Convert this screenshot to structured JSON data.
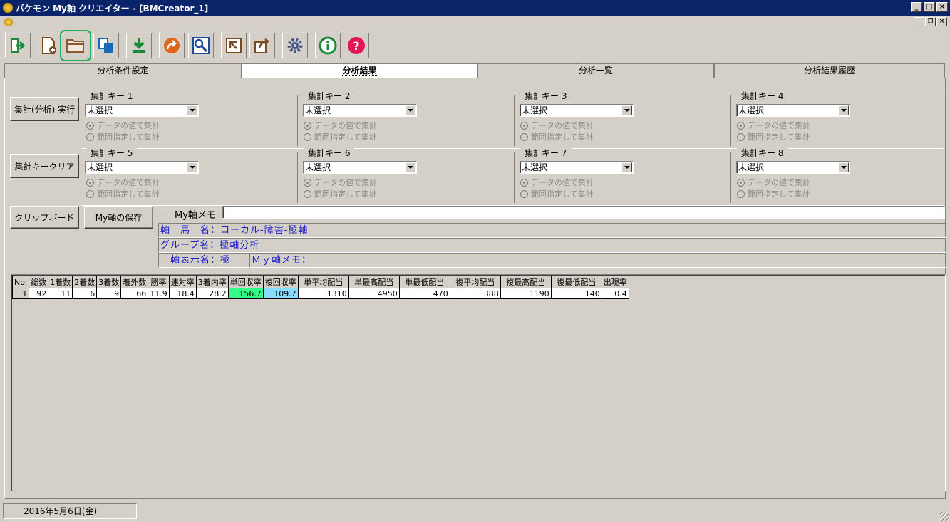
{
  "window": {
    "title": "パケモン My軸 クリエイター - [BMCreator_1]"
  },
  "tabs": [
    {
      "label": "分析条件設定",
      "active": false
    },
    {
      "label": "分析結果",
      "active": true
    },
    {
      "label": "分析一覧",
      "active": false
    },
    {
      "label": "分析結果履歴",
      "active": false
    }
  ],
  "buttons": {
    "run": "集計(分析) 実行",
    "clear": "集計キークリア",
    "clipboard": "クリップボード",
    "save": "My軸の保存"
  },
  "keys": [
    {
      "title": "集計キー 1",
      "value": "未選択"
    },
    {
      "title": "集計キー 2",
      "value": "未選択"
    },
    {
      "title": "集計キー 3",
      "value": "未選択"
    },
    {
      "title": "集計キー 4",
      "value": "未選択"
    },
    {
      "title": "集計キー 5",
      "value": "未選択"
    },
    {
      "title": "集計キー 6",
      "value": "未選択"
    },
    {
      "title": "集計キー 7",
      "value": "未選択"
    },
    {
      "title": "集計キー 8",
      "value": "未選択"
    }
  ],
  "radio_labels": {
    "by_value": "データの値で集計",
    "by_range": "範囲指定して集計"
  },
  "memo": {
    "label": "My軸メモ",
    "value": ""
  },
  "info": {
    "axis_name": "軸　馬　名：ローカル-障害-極軸",
    "group_name": "グループ名：極軸分析",
    "display_name": "軸表示名：極",
    "axis_memo": "Ｍｙ軸メモ："
  },
  "grid": {
    "headers": [
      "No.",
      "総数",
      "1着数",
      "2着数",
      "3着数",
      "着外数",
      "勝率",
      "連対率",
      "3着内率",
      "単回収率",
      "複回収率",
      "単平均配当",
      "単最高配当",
      "単最低配当",
      "複平均配当",
      "複最高配当",
      "複最低配当",
      "出現率"
    ],
    "rows": [
      [
        "1",
        "92",
        "11",
        "6",
        "9",
        "66",
        "11.9",
        "18.4",
        "28.2",
        "156.7",
        "109.7",
        "1310",
        "4950",
        "470",
        "388",
        "1190",
        "140",
        "0.4"
      ]
    ],
    "highlight_colors": {
      "単回収率": "#33ff88",
      "複回収率": "#88ddff"
    }
  },
  "status": {
    "date": "2016年5月6日(金)"
  }
}
